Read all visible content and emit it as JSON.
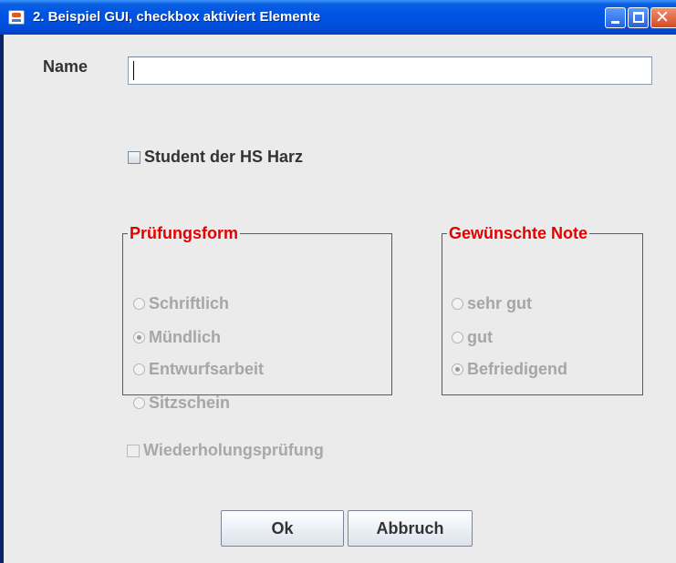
{
  "window": {
    "title": "2. Beispiel GUI, checkbox aktiviert Elemente",
    "controls": {
      "minimize": "minimize",
      "maximize": "maximize",
      "close": "close"
    }
  },
  "form": {
    "name_label": "Name",
    "name_value": "",
    "student_checkbox": {
      "label": "Student der HS Harz",
      "checked": false
    },
    "pruefungsform": {
      "title": "Prüfungsform",
      "options": [
        {
          "label": "Schriftlich",
          "selected": false
        },
        {
          "label": "Mündlich",
          "selected": true
        },
        {
          "label": "Entwurfsarbeit",
          "selected": false
        },
        {
          "label": "Sitzschein",
          "selected": false
        }
      ],
      "enabled": false
    },
    "gewuenschte_note": {
      "title": "Gewünschte Note",
      "options": [
        {
          "label": "sehr gut",
          "selected": false
        },
        {
          "label": "gut",
          "selected": false
        },
        {
          "label": "Befriedigend",
          "selected": true
        }
      ],
      "enabled": false
    },
    "wiederholung_checkbox": {
      "label": "Wiederholungsprüfung",
      "checked": false,
      "enabled": false
    }
  },
  "buttons": {
    "ok": "Ok",
    "cancel": "Abbruch"
  },
  "colors": {
    "titlebar": "#0054e3",
    "group_title": "#e50000",
    "disabled_text": "#a6a6a6",
    "panel_bg": "#ebebeb"
  }
}
